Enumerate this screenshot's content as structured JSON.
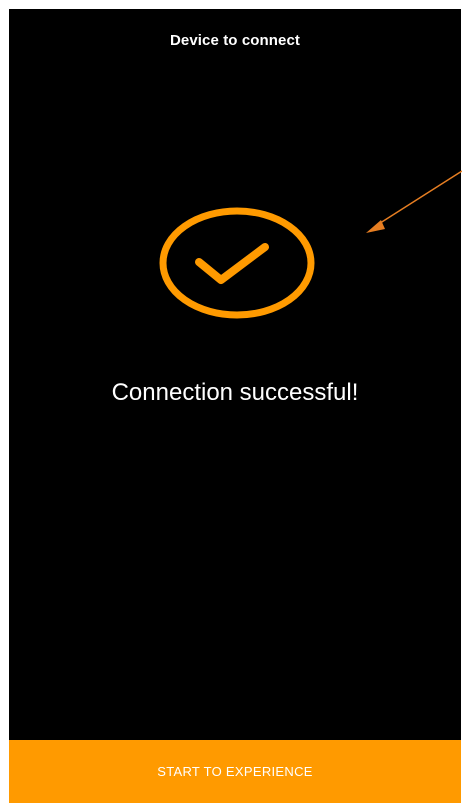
{
  "header": {
    "title": "Device to connect"
  },
  "status": {
    "icon": "check-circle-icon",
    "message": "Connection successful!"
  },
  "action": {
    "start_label": "START TO EXPERIENCE"
  },
  "colors": {
    "background": "#000000",
    "accent": "#ff9a00",
    "annotation": "#e67e22",
    "text": "#ffffff"
  }
}
